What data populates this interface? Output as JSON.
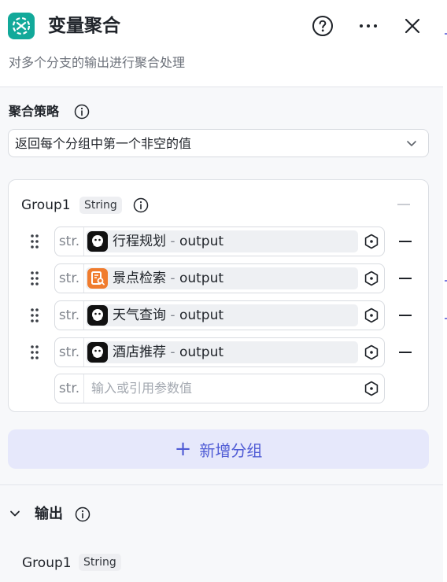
{
  "header": {
    "title": "变量聚合",
    "subtitle": "对多个分支的输出进行聚合处理",
    "icon": "variable-merge-icon",
    "accent": "#12a99a"
  },
  "strategy": {
    "label": "聚合策略",
    "selected": "返回每个分组中第一个非空的值"
  },
  "group": {
    "name": "Group1",
    "type": "String",
    "rows": [
      {
        "type_label": "str.",
        "source": "行程规划",
        "sep": "-",
        "var": "output",
        "icon": "bot-avatar-icon"
      },
      {
        "type_label": "str.",
        "source": "景点检索",
        "sep": "-",
        "var": "output",
        "icon": "search-plugin-icon"
      },
      {
        "type_label": "str.",
        "source": "天气查询",
        "sep": "-",
        "var": "output",
        "icon": "bot-avatar-icon"
      },
      {
        "type_label": "str.",
        "source": "酒店推荐",
        "sep": "-",
        "var": "output",
        "icon": "bot-avatar-icon"
      }
    ],
    "empty_row": {
      "type_label": "str.",
      "placeholder": "输入或引用参数值"
    }
  },
  "add_group": {
    "label": "新增分组",
    "color": "#4f5bd5"
  },
  "output": {
    "label": "输出",
    "name": "Group1",
    "type": "String"
  }
}
